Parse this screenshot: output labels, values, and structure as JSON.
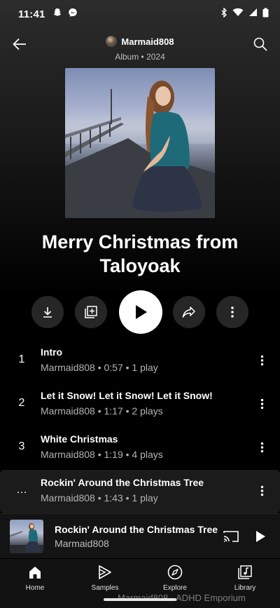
{
  "status_bar": {
    "time": "11:41",
    "left_icons": [
      "snapchat-icon",
      "messenger-icon"
    ],
    "right_icons": [
      "bluetooth-icon",
      "wifi-icon",
      "signal-icon",
      "battery-icon"
    ]
  },
  "header": {
    "artist_name": "Marmaid808",
    "album_meta": "Album • 2024"
  },
  "album": {
    "title": "Merry Christmas from Taloyoak"
  },
  "actions": [
    "download-icon",
    "add-to-playlist-icon",
    "play-icon",
    "share-icon",
    "more-icon"
  ],
  "tracks": [
    {
      "number": "1",
      "title": "Intro",
      "subtitle": "Marmaid808 • 0:57 • 1 play"
    },
    {
      "number": "2",
      "title": "Let it Snow! Let it Snow! Let it Snow!",
      "subtitle": "Marmaid808 • 1:17 • 2 plays"
    },
    {
      "number": "3",
      "title": "White Christmas",
      "subtitle": "Marmaid808 • 1:19 • 4 plays"
    },
    {
      "number": "…",
      "title": "Rockin' Around the Christmas Tree",
      "subtitle": "Marmaid808 • 1:43 • 1 play"
    }
  ],
  "mini_player": {
    "title": "Rockin' Around the Christmas Tree",
    "artist": "Marmaid808"
  },
  "nav": [
    {
      "label": "Home",
      "icon": "home-icon"
    },
    {
      "label": "Samples",
      "icon": "samples-icon"
    },
    {
      "label": "Explore",
      "icon": "compass-icon"
    },
    {
      "label": "Library",
      "icon": "library-icon"
    }
  ],
  "watermark": "Marmaid808 - ADHD Emporium"
}
